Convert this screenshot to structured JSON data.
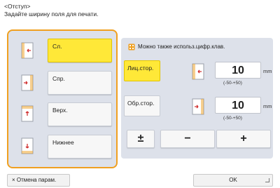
{
  "header": {
    "title": "<Отступ>",
    "subtitle": "Задайте ширину поля для печати."
  },
  "edges": [
    {
      "label": "Сл.",
      "active": true,
      "icon": "margin-left-icon"
    },
    {
      "label": "Спр.",
      "active": false,
      "icon": "margin-right-icon"
    },
    {
      "label": "Верх.",
      "active": false,
      "icon": "margin-top-icon"
    },
    {
      "label": "Нижнее",
      "active": false,
      "icon": "margin-bottom-icon"
    }
  ],
  "info": {
    "text": "Можно также использ.цифр.клав.",
    "icon": "keypad-info-icon"
  },
  "front": {
    "label": "Лиц.стор.",
    "value": "10",
    "unit": "mm",
    "range": "(-50-+50)"
  },
  "back": {
    "label": "Обр.стор.",
    "value": "10",
    "unit": "mm",
    "range": "(-50-+50)"
  },
  "keys": {
    "plus_minus": "±",
    "minus": "−",
    "plus": "+"
  },
  "footer": {
    "cancel_label": "Отмена парам.",
    "cancel_icon": "×",
    "ok_label": "OK"
  },
  "colors": {
    "accent_yellow": "#ffe838",
    "focus_orange": "#f0a020",
    "panel_bg": "#dde1ea"
  }
}
